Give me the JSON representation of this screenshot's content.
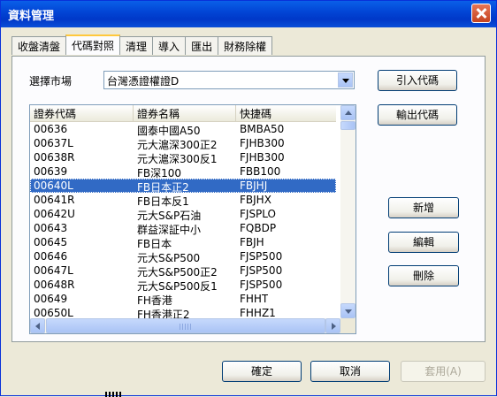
{
  "window": {
    "title": "資料管理"
  },
  "tabs": [
    "收盤清盤",
    "代碼對照",
    "清理",
    "導入",
    "匯出",
    "財務除權"
  ],
  "market": {
    "label": "選擇市場",
    "value": "台灣憑證權證D"
  },
  "side_buttons": {
    "import": "引入代碼",
    "export": "輸出代碼",
    "add": "新增",
    "edit": "編輯",
    "delete": "刪除"
  },
  "table": {
    "columns": [
      "證券代碼",
      "證券名稱",
      "快捷碼"
    ],
    "rows": [
      [
        "00636",
        "國泰中國A50",
        "BMBA50"
      ],
      [
        "00637L",
        "元大滬深300正2",
        "FJHB300"
      ],
      [
        "00638R",
        "元大滬深300反1",
        "FJHB300"
      ],
      [
        "00639",
        "FB深100",
        "FBB100"
      ],
      [
        "00640L",
        "FB日本正2",
        "FBJHJ"
      ],
      [
        "00641R",
        "FB日本反1",
        "FBJHX"
      ],
      [
        "00642U",
        "元大S&P石油",
        "FJSPLO"
      ],
      [
        "00643",
        "群益深証中小",
        "FQBDP"
      ],
      [
        "00645",
        "FB日本",
        "FBJH"
      ],
      [
        "00646",
        "元大S&P500",
        "FJSP500"
      ],
      [
        "00647L",
        "元大S&P500正2",
        "FJSP500"
      ],
      [
        "00648R",
        "元大S&P500反1",
        "FJSP500"
      ],
      [
        "00649",
        "FH香港",
        "FHHT"
      ],
      [
        "00650L",
        "FH香港正2",
        "FHHZ1"
      ]
    ],
    "selected_index": 4
  },
  "footer": {
    "ok": "確定",
    "cancel": "取消",
    "apply": "套用(A)"
  }
}
